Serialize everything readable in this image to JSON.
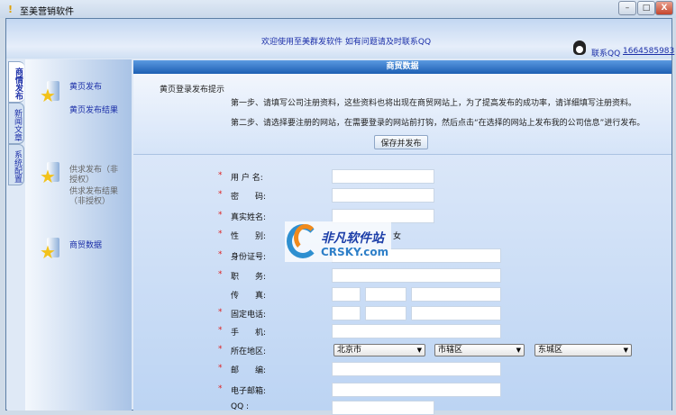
{
  "window": {
    "title": "至美营销软件",
    "controls": {
      "minimize": "–",
      "maximize": "□",
      "close": "X"
    }
  },
  "header": {
    "welcome": "欢迎使用至美群发软件 如有问题请及时联系QQ",
    "qq_label": "联系QQ",
    "qq_number": "1664585983"
  },
  "tabs": [
    {
      "label": "商情发布",
      "active": true
    },
    {
      "label": "新闻文章",
      "active": false
    },
    {
      "label": "系统配置",
      "active": false
    }
  ],
  "sidebar": {
    "groups": [
      {
        "items": [
          "黄页发布",
          "黄页发布结果"
        ],
        "enabled": true
      },
      {
        "items": [
          "供求发布（非授权）",
          "供求发布结果（非授权）"
        ],
        "enabled": false
      },
      {
        "items": [
          "商贸数据"
        ],
        "enabled": true
      }
    ]
  },
  "main": {
    "title": "商贸数据",
    "tip_title": "黄页登录发布提示",
    "step1": "第一步、请填写公司注册资料，这些资料也将出现在商贸网站上，为了提高发布的成功率，请详细填写注册资料。",
    "step2": "第二步、请选择要注册的网站，在需要登录的网站前打钩，然后点击“在选择的网站上发布我的公司信息”进行发布。",
    "save_button": "保存并发布",
    "required_mark": "*",
    "form": {
      "username": "用 户 名:",
      "password": "密　　码:",
      "realname": "真实姓名:",
      "gender": "性　　别:",
      "gender_female": "女",
      "idcard": "身份证号:",
      "position": "职　　务:",
      "fax": "传　　真:",
      "phone": "固定电话:",
      "mobile": "手　　机:",
      "region": "所在地区:",
      "region_province": "北京市",
      "region_city": "市辖区",
      "region_district": "东城区",
      "zip": "邮　　编:",
      "email": "电子邮箱:",
      "qq": "QQ :"
    }
  },
  "watermark": {
    "cn": "非凡软件站",
    "en": "CRSKY.com"
  }
}
